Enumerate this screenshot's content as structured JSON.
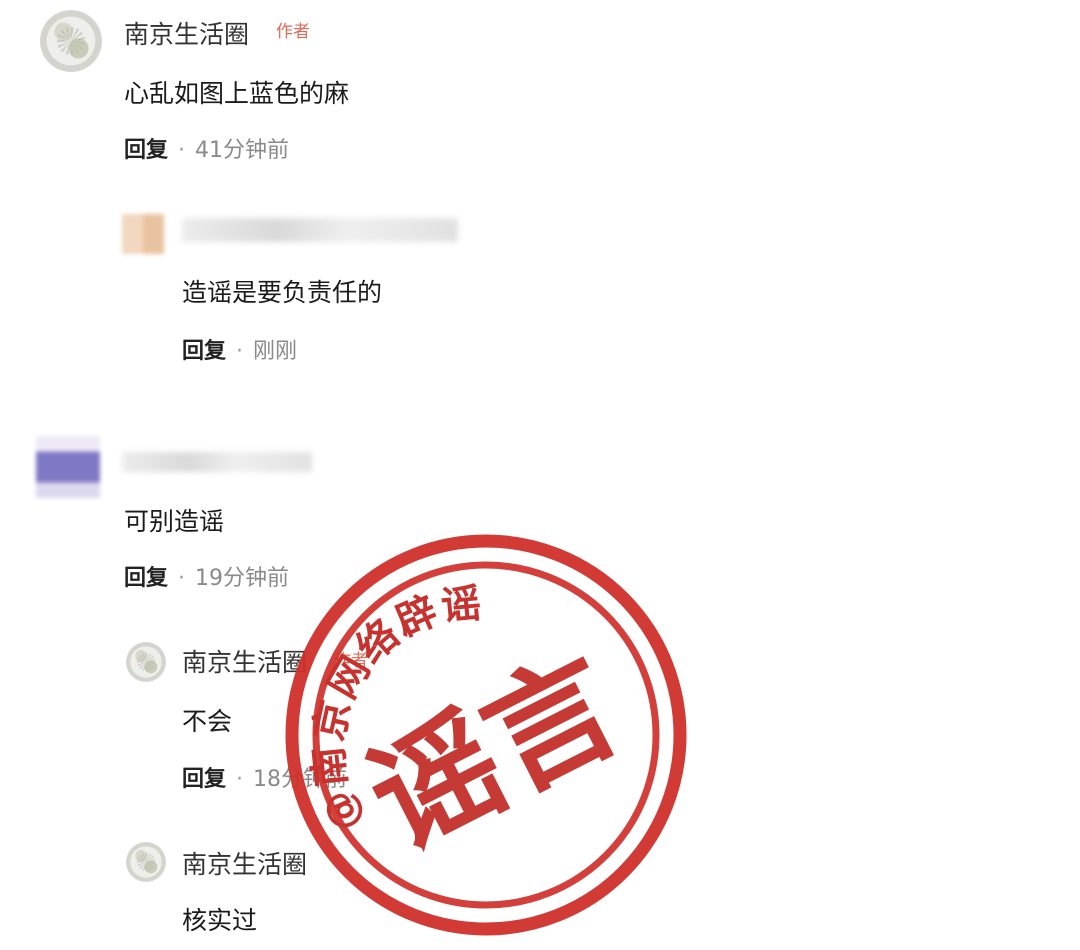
{
  "comments": [
    {
      "author": "南京生活圈",
      "badge": "作者",
      "text": "心乱如图上蓝色的麻",
      "reply_label": "回复",
      "time": "41分钟前"
    },
    {
      "author": "",
      "text": "造谣是要负责任的",
      "reply_label": "回复",
      "time": "刚刚"
    },
    {
      "author": "",
      "text": "可别造谣",
      "reply_label": "回复",
      "time": "19分钟前"
    },
    {
      "author": "南京生活圈",
      "badge": "作者",
      "text": "不会",
      "reply_label": "回复",
      "time": "18分钟前"
    },
    {
      "author": "南京生活圈",
      "text": "核实过"
    }
  ],
  "stamp": {
    "arc_text": "@南京网络辟谣",
    "center_text": "谣言",
    "color": "#c53a35"
  },
  "colors": {
    "author_badge": "#e46a57",
    "meta_text": "#8a8a8a",
    "primary_text": "#1b1b1b"
  },
  "icons": {
    "avatar": "circle-avatar"
  }
}
